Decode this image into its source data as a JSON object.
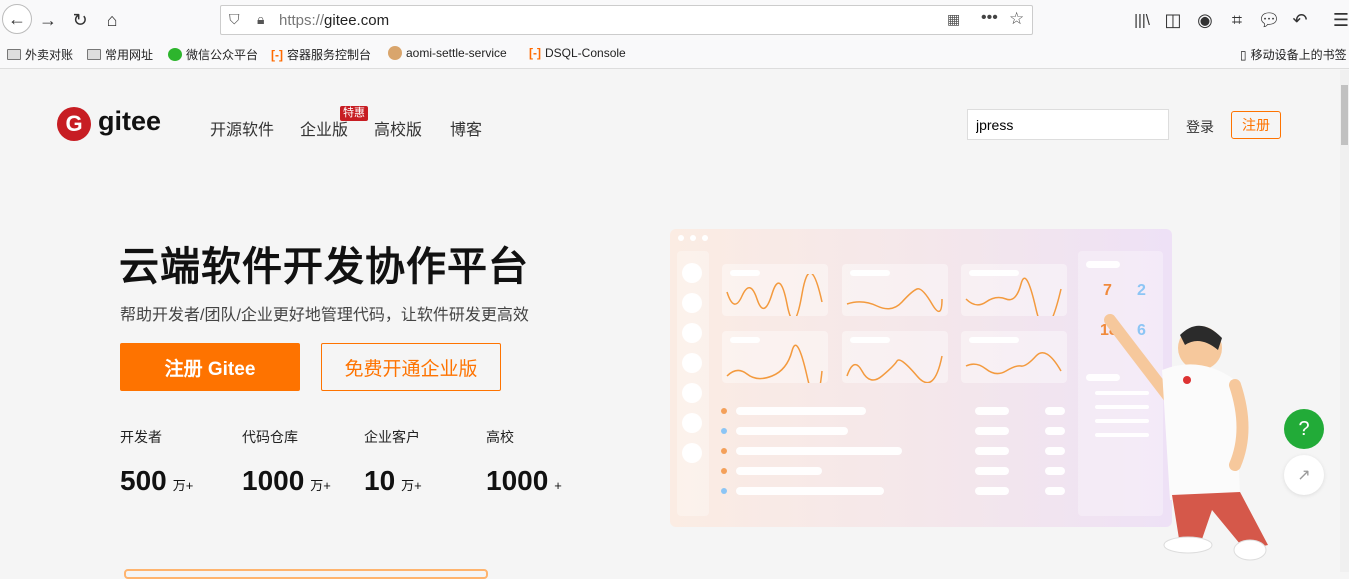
{
  "browser": {
    "url_scheme": "https://",
    "url_host": "gitee.com",
    "bookmarks": [
      "外卖对账",
      "常用网址",
      "微信公众平台",
      "容器服务控制台",
      "aomi-settle-service",
      "DSQL-Console"
    ],
    "mobile_bookmarks": "移动设备上的书签"
  },
  "header": {
    "logo": "gitee",
    "nav": [
      "开源软件",
      "企业版",
      "高校版",
      "博客"
    ],
    "badge": "特惠",
    "search_value": "jpress",
    "login": "登录",
    "register": "注册"
  },
  "hero": {
    "title": "云端软件开发协作平台",
    "subtitle": "帮助开发者/团队/企业更好地管理代码，让软件研发更高效",
    "primary_button": "注册 Gitee",
    "secondary_button": "免费开通企业版",
    "stats": [
      {
        "label": "开发者",
        "value": "500",
        "unit": "万+"
      },
      {
        "label": "代码仓库",
        "value": "1000",
        "unit": "万+"
      },
      {
        "label": "企业客户",
        "value": "10",
        "unit": "万+"
      },
      {
        "label": "高校",
        "value": "1000",
        "unit": "+"
      }
    ]
  },
  "illustration": {
    "numbers": [
      "7",
      "2",
      "18",
      "6"
    ]
  },
  "floating": {
    "help": "?"
  },
  "colors": {
    "brand": "#c71d23",
    "accent": "#fe7300",
    "help": "#22ab38"
  }
}
